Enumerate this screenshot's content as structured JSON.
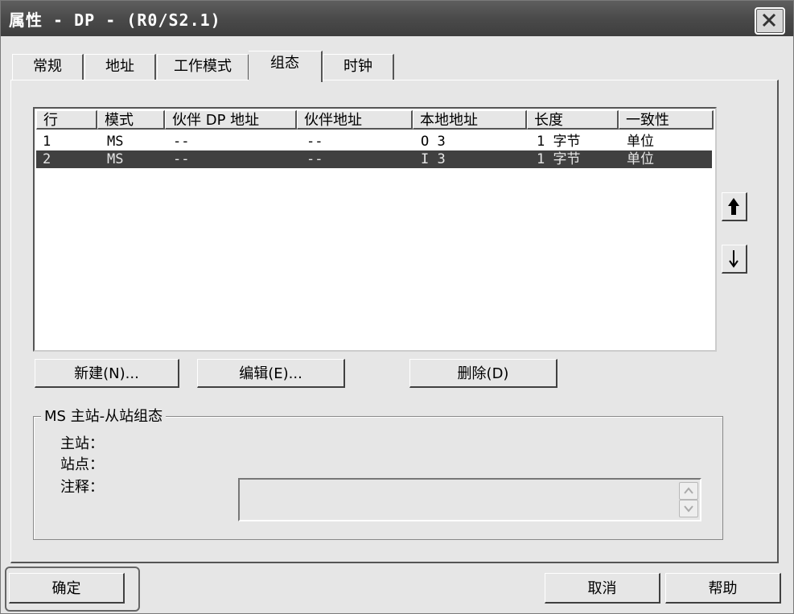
{
  "window": {
    "title": "属性 - DP - (R0/S2.1)"
  },
  "tabs": [
    {
      "label": "常规",
      "active": false
    },
    {
      "label": "地址",
      "active": false
    },
    {
      "label": "工作模式",
      "active": false
    },
    {
      "label": "组态",
      "active": true
    },
    {
      "label": "时钟",
      "active": false
    }
  ],
  "table": {
    "columns": [
      "行",
      "模式",
      "伙伴 DP 地址",
      "伙伴地址",
      "本地地址",
      "长度",
      "一致性"
    ],
    "rows": [
      {
        "row": "1",
        "mode": "MS",
        "partner_dp_addr": "--",
        "partner_addr": "--",
        "local_addr": "O 3",
        "length": "1 字节",
        "consistency": "单位",
        "selected": false
      },
      {
        "row": "2",
        "mode": "MS",
        "partner_dp_addr": "--",
        "partner_addr": "--",
        "local_addr": "I 3",
        "length": "1 字节",
        "consistency": "单位",
        "selected": true
      }
    ]
  },
  "buttons": {
    "new": "新建(N)...",
    "edit": "编辑(E)...",
    "delete": "删除(D)",
    "ok": "确定",
    "cancel": "取消",
    "help": "帮助"
  },
  "icons": {
    "move_up": "arrow-up-icon",
    "move_down": "arrow-down-icon",
    "close": "close-icon"
  },
  "group": {
    "legend": "MS 主站-从站组态",
    "master_label": "主站：",
    "station_label": "站点：",
    "comment_label": "注释："
  }
}
